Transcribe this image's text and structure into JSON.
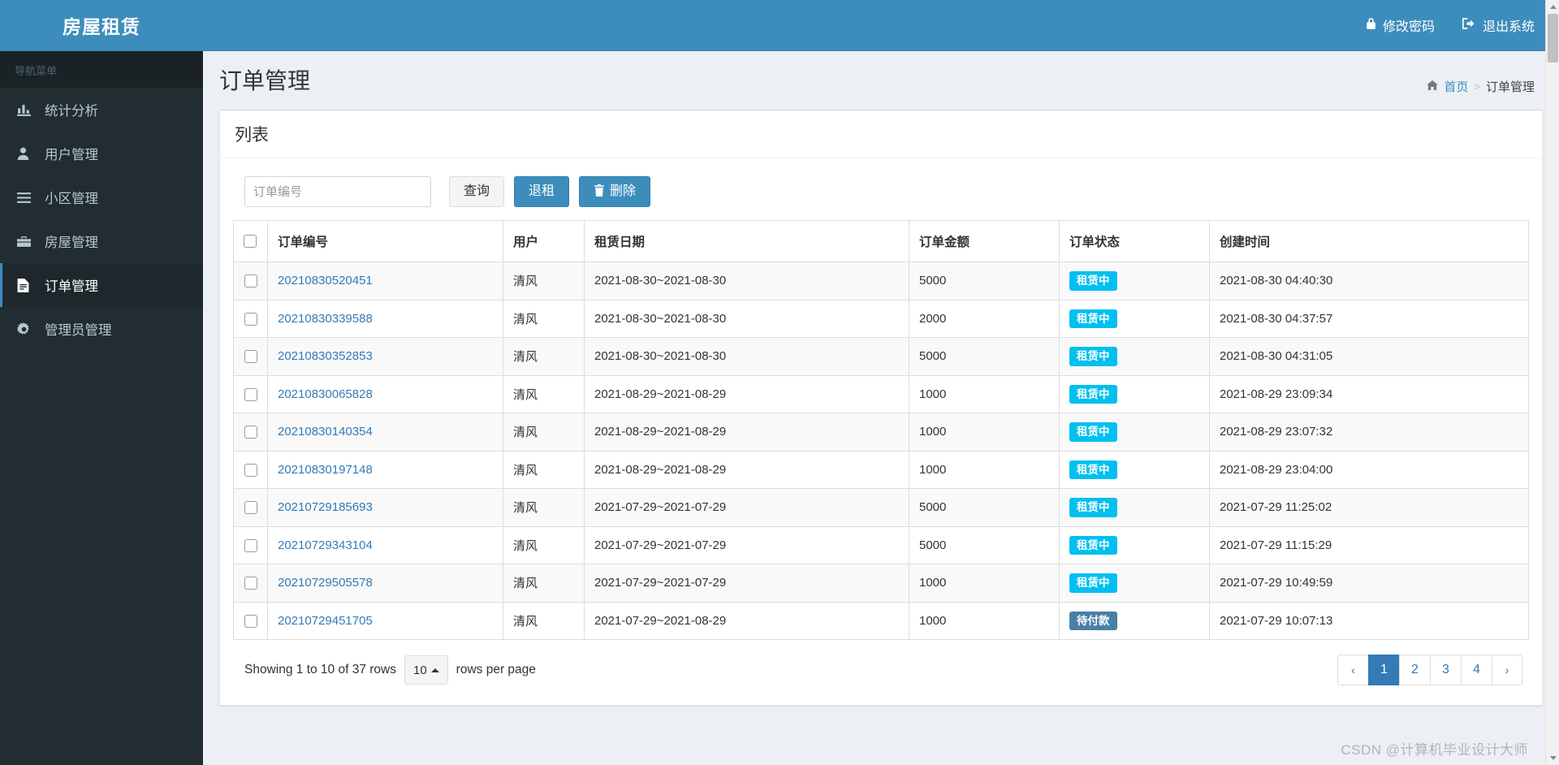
{
  "brand": {
    "title": "房屋租赁"
  },
  "topbar": {
    "change_password": "修改密码",
    "logout": "退出系统"
  },
  "sidebar": {
    "nav_header": "导航菜单",
    "items": [
      {
        "label": "统计分析",
        "icon": "chart-bar-icon",
        "active": false
      },
      {
        "label": "用户管理",
        "icon": "user-icon",
        "active": false
      },
      {
        "label": "小区管理",
        "icon": "list-icon",
        "active": false
      },
      {
        "label": "房屋管理",
        "icon": "briefcase-icon",
        "active": false
      },
      {
        "label": "订单管理",
        "icon": "file-text-icon",
        "active": true
      },
      {
        "label": "管理员管理",
        "icon": "gear-icon",
        "active": false
      }
    ]
  },
  "page": {
    "title": "订单管理",
    "breadcrumb": {
      "home": "首页",
      "separator": ">",
      "current": "订单管理"
    }
  },
  "box": {
    "title": "列表"
  },
  "toolbar": {
    "search_placeholder": "订单编号",
    "search_value": "",
    "query_label": "查询",
    "checkout_label": "退租",
    "delete_label": "删除",
    "delete_icon": "trash-icon"
  },
  "table": {
    "headers": [
      "订单编号",
      "用户",
      "租赁日期",
      "订单金额",
      "订单状态",
      "创建时间"
    ],
    "rows": [
      {
        "order_no": "20210830520451",
        "user": "清风",
        "rent_date": "2021-08-30~2021-08-30",
        "amount": "5000",
        "status": "租赁中",
        "status_kind": "info",
        "created": "2021-08-30 04:40:30"
      },
      {
        "order_no": "20210830339588",
        "user": "清风",
        "rent_date": "2021-08-30~2021-08-30",
        "amount": "2000",
        "status": "租赁中",
        "status_kind": "info",
        "created": "2021-08-30 04:37:57"
      },
      {
        "order_no": "20210830352853",
        "user": "清风",
        "rent_date": "2021-08-30~2021-08-30",
        "amount": "5000",
        "status": "租赁中",
        "status_kind": "info",
        "created": "2021-08-30 04:31:05"
      },
      {
        "order_no": "20210830065828",
        "user": "清风",
        "rent_date": "2021-08-29~2021-08-29",
        "amount": "1000",
        "status": "租赁中",
        "status_kind": "info",
        "created": "2021-08-29 23:09:34"
      },
      {
        "order_no": "20210830140354",
        "user": "清风",
        "rent_date": "2021-08-29~2021-08-29",
        "amount": "1000",
        "status": "租赁中",
        "status_kind": "info",
        "created": "2021-08-29 23:07:32"
      },
      {
        "order_no": "20210830197148",
        "user": "清风",
        "rent_date": "2021-08-29~2021-08-29",
        "amount": "1000",
        "status": "租赁中",
        "status_kind": "info",
        "created": "2021-08-29 23:04:00"
      },
      {
        "order_no": "20210729185693",
        "user": "清风",
        "rent_date": "2021-07-29~2021-07-29",
        "amount": "5000",
        "status": "租赁中",
        "status_kind": "info",
        "created": "2021-07-29 11:25:02"
      },
      {
        "order_no": "20210729343104",
        "user": "清风",
        "rent_date": "2021-07-29~2021-07-29",
        "amount": "5000",
        "status": "租赁中",
        "status_kind": "info",
        "created": "2021-07-29 11:15:29"
      },
      {
        "order_no": "20210729505578",
        "user": "清风",
        "rent_date": "2021-07-29~2021-07-29",
        "amount": "1000",
        "status": "租赁中",
        "status_kind": "info",
        "created": "2021-07-29 10:49:59"
      },
      {
        "order_no": "20210729451705",
        "user": "清风",
        "rent_date": "2021-07-29~2021-08-29",
        "amount": "1000",
        "status": "待付款",
        "status_kind": "pending",
        "created": "2021-07-29 10:07:13"
      }
    ]
  },
  "footer": {
    "showing_text": "Showing 1 to 10 of 37 rows",
    "page_size": "10",
    "rows_per_page_text": "rows per page",
    "pagination": {
      "prev": "‹",
      "next": "›",
      "pages": [
        "1",
        "2",
        "3",
        "4"
      ],
      "active": "1"
    }
  },
  "watermark": "CSDN @计算机毕业设计大师",
  "colors": {
    "brand_blue": "#3c8dbc",
    "sidebar_dark": "#222d32",
    "content_bg": "#ecf0f5",
    "badge_info": "#00c0ef",
    "badge_pending": "#4a7fa5",
    "link_blue": "#337ab7"
  }
}
